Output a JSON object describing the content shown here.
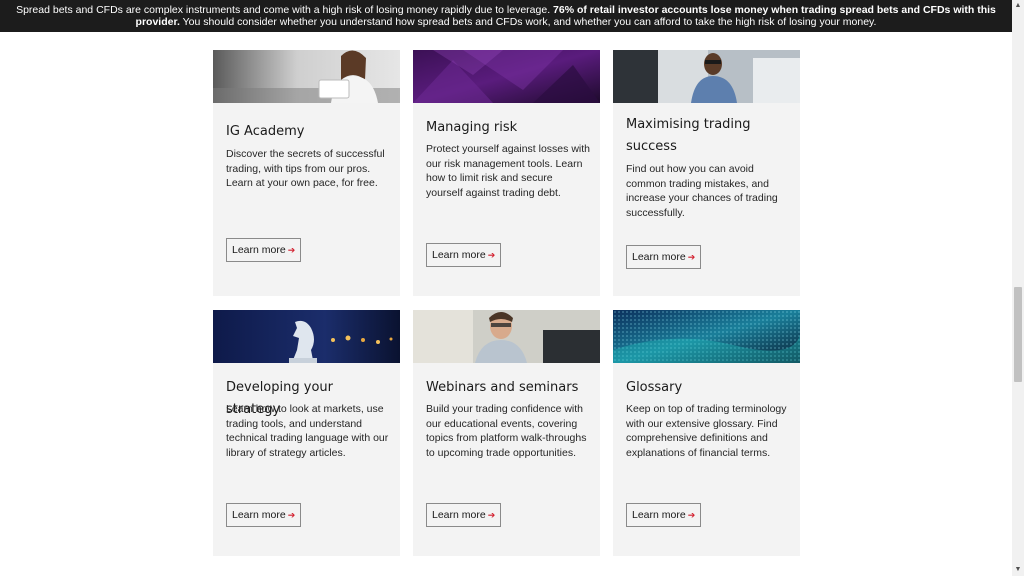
{
  "banner": {
    "text_regular": "Spread bets and CFDs are complex instruments and come with a high risk of losing money rapidly due to leverage.",
    "text_bold": "76% of retail investor accounts lose money when trading spread bets and CFDs with this provider.",
    "text_regular_2": "You should consider whether you understand how spread bets and CFDs work, and whether you can afford to take the high risk of losing your money."
  },
  "cards": [
    {
      "title": "IG Academy",
      "description": "Discover the secrets of successful trading, with tips from our pros. Learn at your own pace, for free.",
      "button": "Learn more",
      "image": "woman-reading-tablet-photo"
    },
    {
      "title": "Managing risk",
      "description": "Protect yourself against losses with our risk management tools. Learn how to limit risk and secure yourself against trading debt.",
      "button": "Learn more",
      "image": "purple-abstract-photo"
    },
    {
      "title": "Maximising trading success",
      "description": "Find out how you can avoid common trading mistakes, and increase your chances of trading successfully.",
      "button": "Learn more",
      "image": "man-at-computer-photo"
    },
    {
      "title": "Developing your strategy",
      "description": "Learn how to look at markets, use trading tools, and understand technical trading language with our library of strategy articles.",
      "button": "Learn more",
      "image": "chess-knight-photo"
    },
    {
      "title": "Webinars and seminars",
      "description": "Build your trading confidence with our educational events, covering topics from platform walk-throughs to upcoming trade opportunities.",
      "button": "Learn more",
      "image": "smiling-man-photo"
    },
    {
      "title": "Glossary",
      "description": "Keep on top of trading terminology with our extensive glossary. Find comprehensive definitions and explanations of financial terms.",
      "button": "Learn more",
      "image": "digital-data-photo"
    }
  ],
  "colors": {
    "banner_bg": "#1c1c1c",
    "card_bg": "#f3f3f3",
    "accent_arrow": "#d3202f"
  }
}
